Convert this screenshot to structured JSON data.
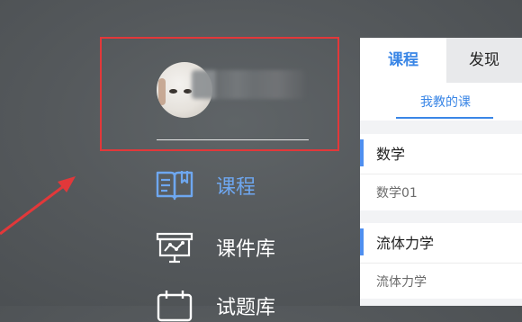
{
  "drawer": {
    "nav": [
      {
        "label": "课程",
        "icon": "book-icon",
        "active": true
      },
      {
        "label": "课件库",
        "icon": "presentation-board-icon",
        "active": false
      },
      {
        "label": "试题库",
        "icon": "calendar-icon",
        "active": false
      }
    ]
  },
  "panel": {
    "tabs": [
      {
        "label": "课程",
        "active": true
      },
      {
        "label": "发现",
        "active": false
      }
    ],
    "subtab": "我教的课",
    "courses": [
      {
        "title": "数学",
        "subtitle": "数学01"
      },
      {
        "title": "流体力学",
        "subtitle": "流体力学"
      }
    ]
  },
  "colors": {
    "accent": "#3a86e6",
    "nav_active": "#6ea7f0",
    "highlight": "#e2383a"
  }
}
